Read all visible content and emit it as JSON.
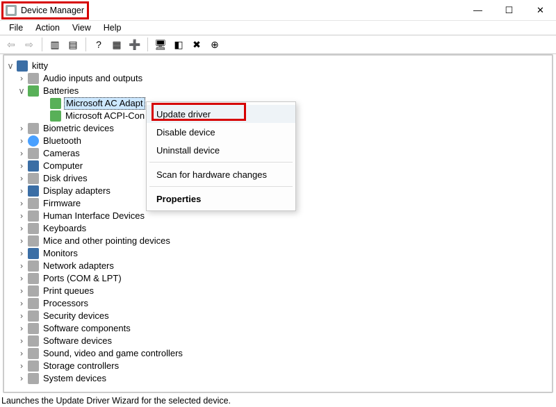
{
  "window": {
    "title": "Device Manager"
  },
  "window_controls": {
    "min": "—",
    "max": "☐",
    "close": "✕"
  },
  "menubar": {
    "items": [
      "File",
      "Action",
      "View",
      "Help"
    ]
  },
  "toolbar": {
    "buttons": [
      {
        "name": "back-icon",
        "glyph": "⇦",
        "disabled": true
      },
      {
        "name": "forward-icon",
        "glyph": "⇨",
        "disabled": true
      },
      {
        "sep": true
      },
      {
        "name": "show-hide-icon",
        "glyph": "▥"
      },
      {
        "name": "properties-icon",
        "glyph": "▤"
      },
      {
        "sep": true
      },
      {
        "name": "help-icon",
        "glyph": "?"
      },
      {
        "name": "view-icon",
        "glyph": "▦"
      },
      {
        "name": "add-hardware-icon",
        "glyph": "➕"
      },
      {
        "sep": true
      },
      {
        "name": "update-driver-icon",
        "glyph": "🖥"
      },
      {
        "name": "scan-icon",
        "glyph": "◧"
      },
      {
        "name": "uninstall-icon",
        "glyph": "✖"
      },
      {
        "name": "more-icon",
        "glyph": "⊕"
      }
    ]
  },
  "tree": {
    "root": {
      "label": "kitty",
      "expanded": true
    },
    "items": [
      {
        "label": "Audio inputs and outputs",
        "icon": "gry",
        "children": false
      },
      {
        "label": "Batteries",
        "icon": "grn",
        "expanded": true,
        "children": [
          {
            "label": "Microsoft AC Adapt",
            "icon": "grn",
            "selected": true
          },
          {
            "label": "Microsoft ACPI-Con",
            "icon": "grn"
          }
        ]
      },
      {
        "label": "Biometric devices",
        "icon": "gry"
      },
      {
        "label": "Bluetooth",
        "icon": "blue"
      },
      {
        "label": "Cameras",
        "icon": "gry"
      },
      {
        "label": "Computer",
        "icon": "mon"
      },
      {
        "label": "Disk drives",
        "icon": "gry"
      },
      {
        "label": "Display adapters",
        "icon": "mon"
      },
      {
        "label": "Firmware",
        "icon": "gry"
      },
      {
        "label": "Human Interface Devices",
        "icon": "gry"
      },
      {
        "label": "Keyboards",
        "icon": "gry"
      },
      {
        "label": "Mice and other pointing devices",
        "icon": "gry"
      },
      {
        "label": "Monitors",
        "icon": "mon"
      },
      {
        "label": "Network adapters",
        "icon": "gry"
      },
      {
        "label": "Ports (COM & LPT)",
        "icon": "gry"
      },
      {
        "label": "Print queues",
        "icon": "gry"
      },
      {
        "label": "Processors",
        "icon": "gry"
      },
      {
        "label": "Security devices",
        "icon": "gry"
      },
      {
        "label": "Software components",
        "icon": "gry"
      },
      {
        "label": "Software devices",
        "icon": "gry"
      },
      {
        "label": "Sound, video and game controllers",
        "icon": "gry"
      },
      {
        "label": "Storage controllers",
        "icon": "gry"
      },
      {
        "label": "System devices",
        "icon": "gry"
      }
    ]
  },
  "context_menu": {
    "items": [
      {
        "label": "Update driver",
        "hover": true,
        "name": "update-driver"
      },
      {
        "label": "Disable device",
        "name": "disable-device"
      },
      {
        "label": "Uninstall device",
        "name": "uninstall-device"
      },
      {
        "sep": true
      },
      {
        "label": "Scan for hardware changes",
        "name": "scan-hardware"
      },
      {
        "sep": true
      },
      {
        "label": "Properties",
        "bold": true,
        "name": "properties"
      }
    ]
  },
  "statusbar": {
    "text": "Launches the Update Driver Wizard for the selected device."
  }
}
